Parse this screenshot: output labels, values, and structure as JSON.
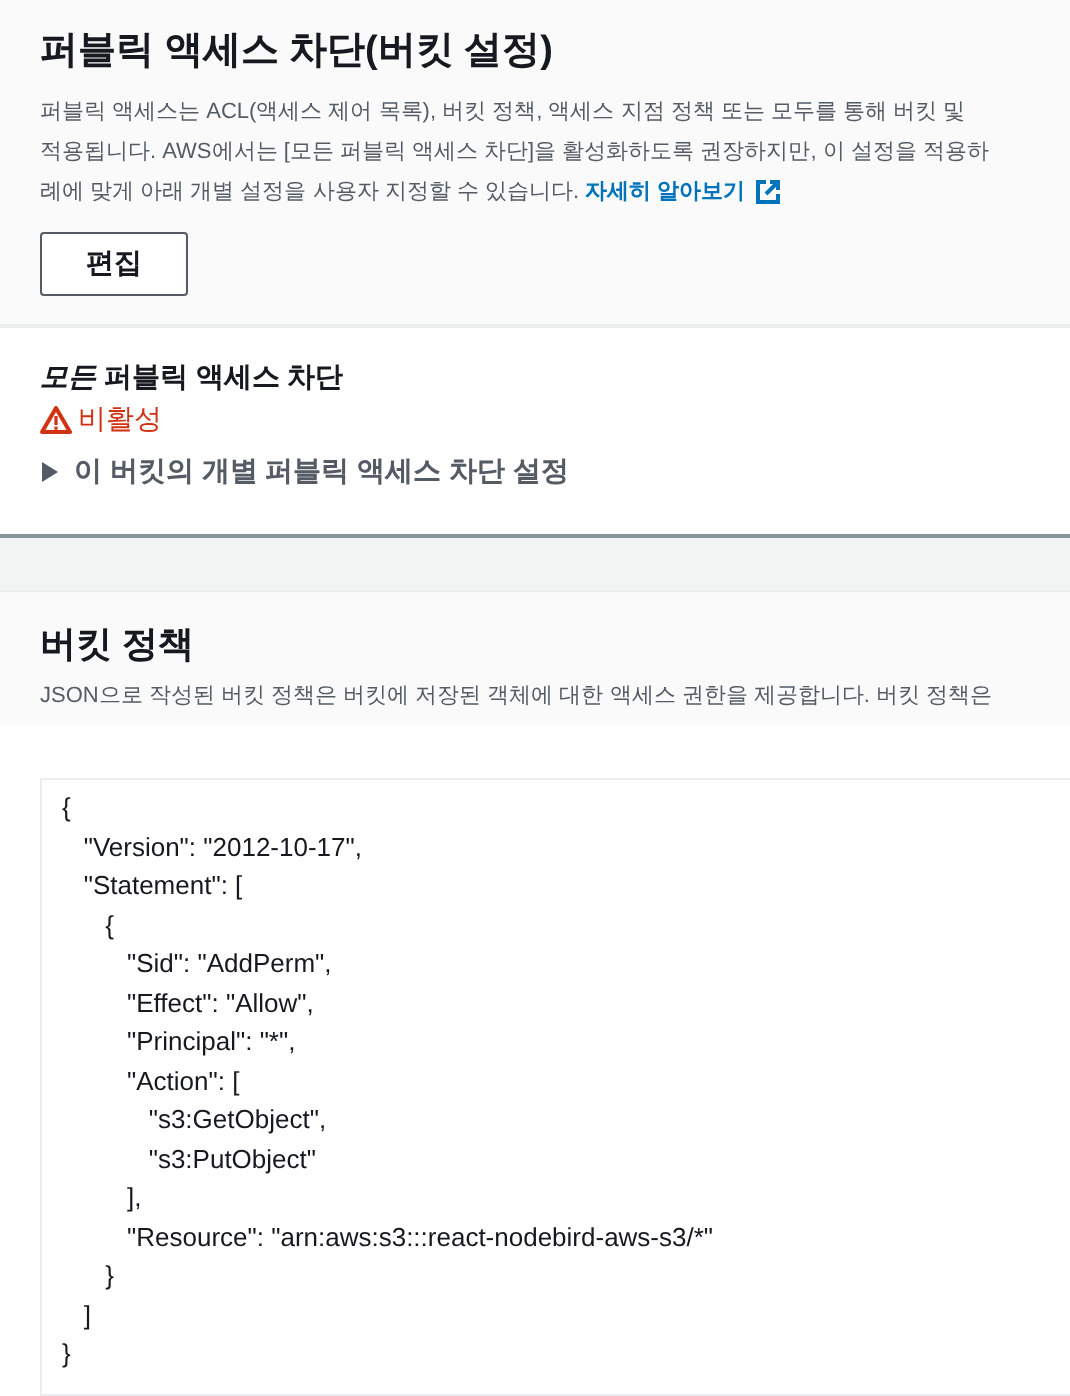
{
  "block_public_access": {
    "title": "퍼블릭 액세스 차단(버킷 설정)",
    "description_lines": [
      "퍼블릭 액세스는 ACL(액세스 제어 목록), 버킷 정책, 액세스 지점 정책 또는 모두를 통해 버킷 및",
      "적용됩니다. AWS에서는 [모든 퍼블릭 액세스 차단]을 활성화하도록 권장하지만, 이 설정을 적용하",
      "례에 맞게 아래 개별 설정을 사용자 지정할 수 있습니다."
    ],
    "learn_more_link": "자세히 알아보기",
    "edit_button": "편집",
    "setting_label": "*모든* 퍼블릭 액세스 차단",
    "status": "비활성",
    "details": {
      "label": "이 버킷의 개별 퍼블릭 액세스 차단 설정",
      "expanded": false
    }
  },
  "bucket_policy": {
    "title": "버킷 정책",
    "description": "JSON으로 작성된 버킷 정책은 버킷에 저장된 객체에 대한 액세스 권한을 제공합니다. 버킷 정책은",
    "code_lines": [
      "{",
      "   \"Version\": \"2012-10-17\",",
      "   \"Statement\": [",
      "      {",
      "         \"Sid\": \"AddPerm\",",
      "         \"Effect\": \"Allow\",",
      "         \"Principal\": \"*\",",
      "         \"Action\": [",
      "            \"s3:GetObject\",",
      "            \"s3:PutObject\"",
      "         ],",
      "         \"Resource\": \"arn:aws:s3:::react-nodebird-aws-s3/*\"",
      "      }",
      "   ]",
      "}"
    ]
  }
}
